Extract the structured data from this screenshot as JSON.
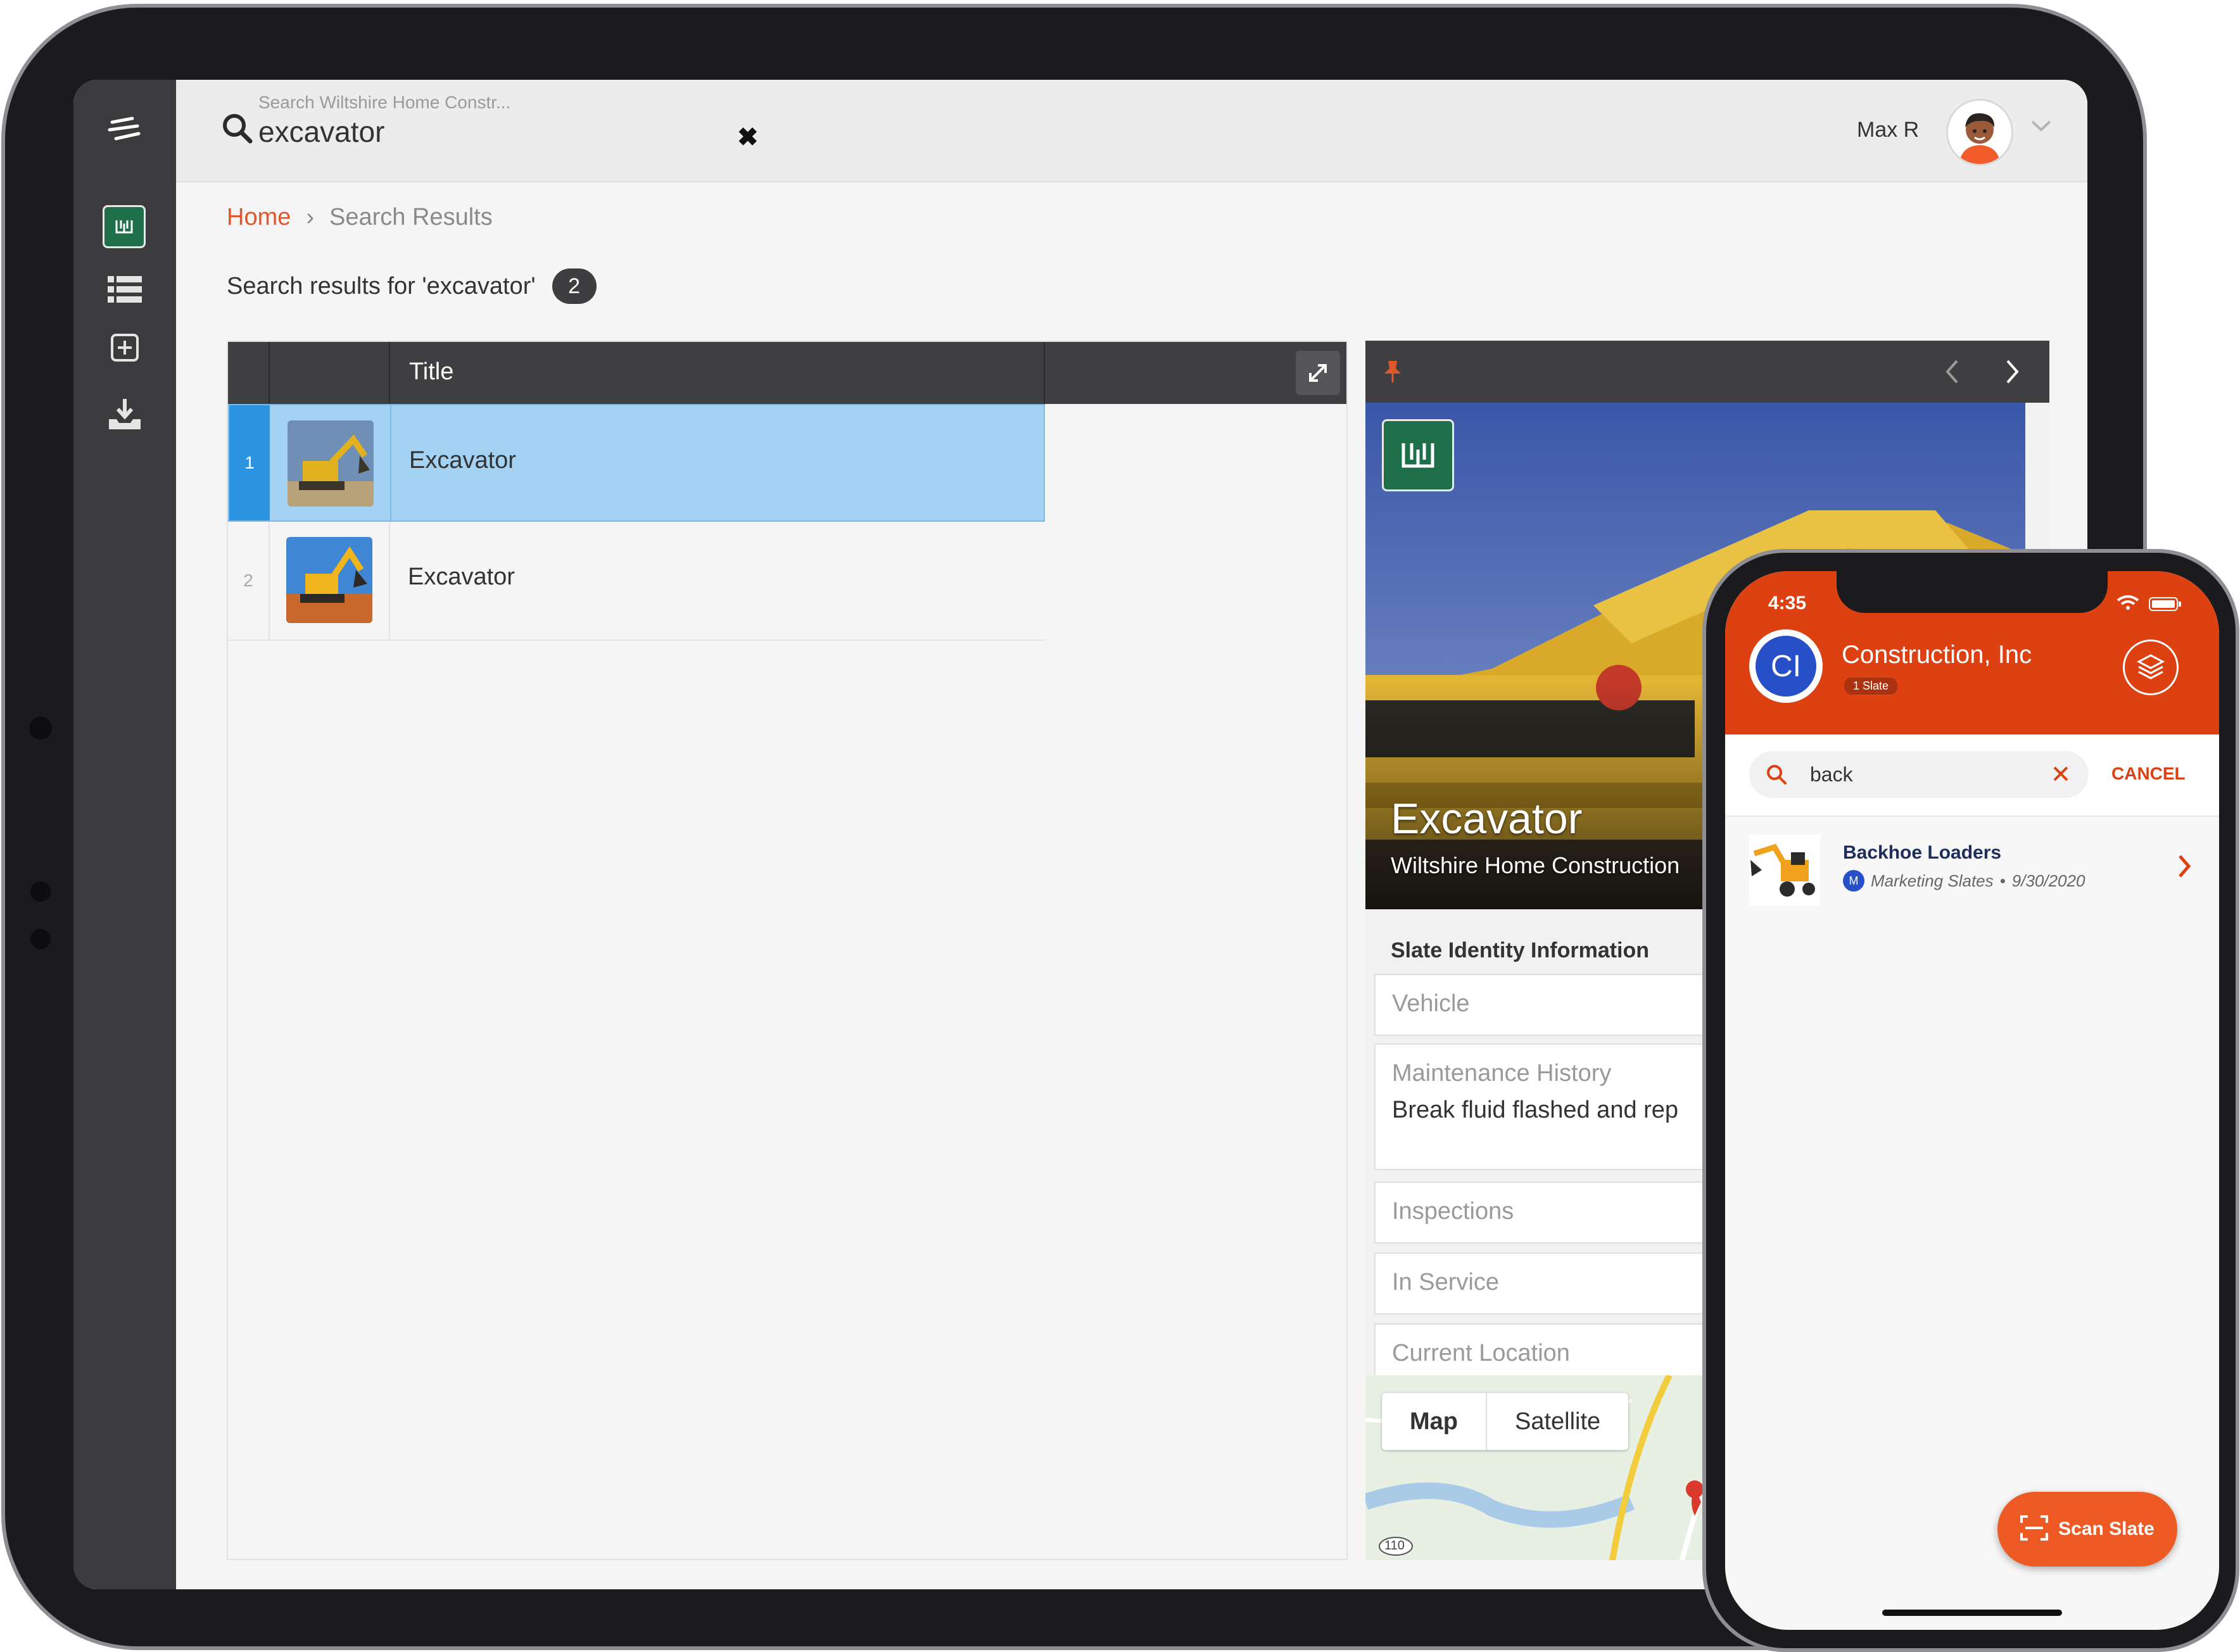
{
  "tablet": {
    "search": {
      "placeholder": "Search Wiltshire Home Constr...",
      "value": "excavator"
    },
    "user": {
      "name": "Max R"
    },
    "breadcrumb": {
      "home": "Home",
      "separator": "›",
      "current": "Search Results"
    },
    "results": {
      "heading": "Search results for 'excavator'",
      "count": "2"
    },
    "grid": {
      "column_title": "Title",
      "rows": [
        {
          "num": "1",
          "title": "Excavator",
          "selected": true
        },
        {
          "num": "2",
          "title": "Excavator",
          "selected": false
        }
      ]
    },
    "detail": {
      "title": "Excavator",
      "subtitle": "Wiltshire Home Construction",
      "section": "Slate Identity Information",
      "fields": [
        {
          "label": "Vehicle",
          "value": ""
        },
        {
          "label": "Maintenance History",
          "value": "Break fluid flashed and rep"
        },
        {
          "label": "Inspections",
          "value": ""
        },
        {
          "label": "In Service",
          "value": ""
        },
        {
          "label": "Current Location",
          "value": ""
        }
      ],
      "map_tabs": {
        "map": "Map",
        "satellite": "Satellite"
      },
      "map_route_label": "110"
    }
  },
  "phone": {
    "status_time": "4:35",
    "org_initials": "CI",
    "org_name": "Construction, Inc",
    "org_badge": "1 Slate",
    "search": {
      "value": "back"
    },
    "cancel_label": "CANCEL",
    "results": [
      {
        "title": "Backhoe Loaders",
        "badge": "M",
        "collection": "Marketing Slates",
        "dot": "•",
        "date": "9/30/2020"
      }
    ],
    "scan_label": "Scan Slate"
  },
  "colors": {
    "accent_orange": "#dd4111",
    "link_orange": "#e0572b",
    "selection_blue": "#a3d2f2",
    "nav_dark": "#3b3b3d",
    "brand_green": "#1e6f4a"
  }
}
